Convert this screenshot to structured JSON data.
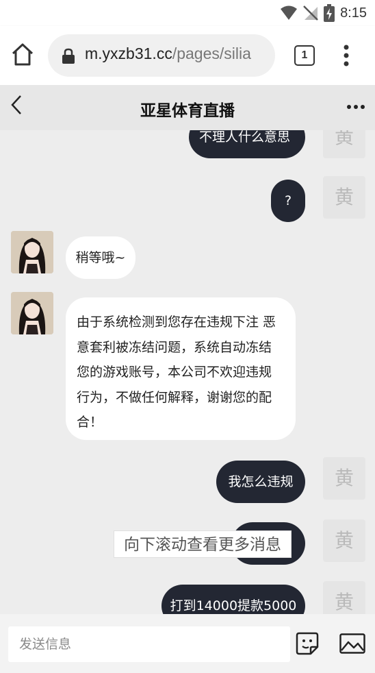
{
  "status_bar": {
    "time": "8:15"
  },
  "browser": {
    "url_host": "m.yxzb31.cc",
    "url_path": "/pages/silia",
    "tab_count": "1"
  },
  "header": {
    "title": "亚星体育直播"
  },
  "chat": {
    "self_avatar_text": "黄",
    "messages": [
      {
        "side": "out",
        "text": "不理人什么意思"
      },
      {
        "side": "out",
        "text": "?"
      },
      {
        "side": "in",
        "text": "稍等哦~"
      },
      {
        "side": "in",
        "lines": [
          "由于系统检测到您存在违规下注 恶",
          "意套利被冻结问题，系统自动冻结",
          "您的游戏账号，本公司不欢迎违规",
          "行为，不做任何解释，谢谢您的配",
          "合！"
        ]
      },
      {
        "side": "out",
        "text": "我怎么违规"
      },
      {
        "side": "out",
        "text": "？？？"
      },
      {
        "side": "out",
        "text": "打到14000提款5000"
      }
    ],
    "scroll_hint": "向下滚动查看更多消息"
  },
  "input": {
    "placeholder": "发送信息"
  }
}
